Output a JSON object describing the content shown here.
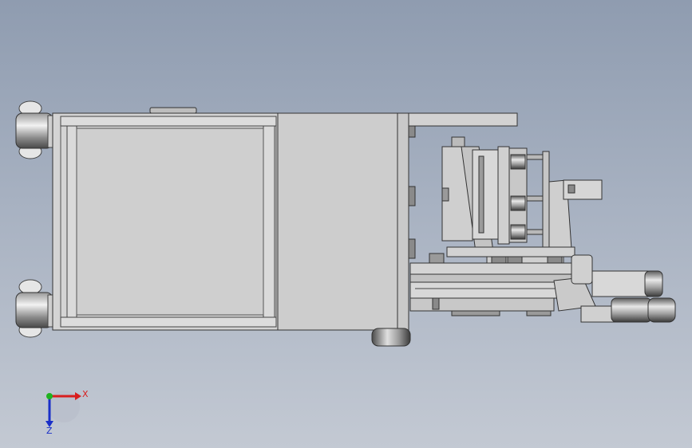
{
  "viewport": {
    "background_top": "#8f9cb0",
    "background_bottom": "#c3c9d3"
  },
  "model": {
    "part_fill": "#d6d6d6",
    "part_edge": "#3a3a3a",
    "panel_fill": "#cfcfcf",
    "dark_fill": "#6e6e6e"
  },
  "triad": {
    "x_label": "X",
    "z_label": "Z",
    "x_color": "#d81e1e",
    "y_color": "#1fb21f",
    "z_color": "#1a2fc8"
  }
}
